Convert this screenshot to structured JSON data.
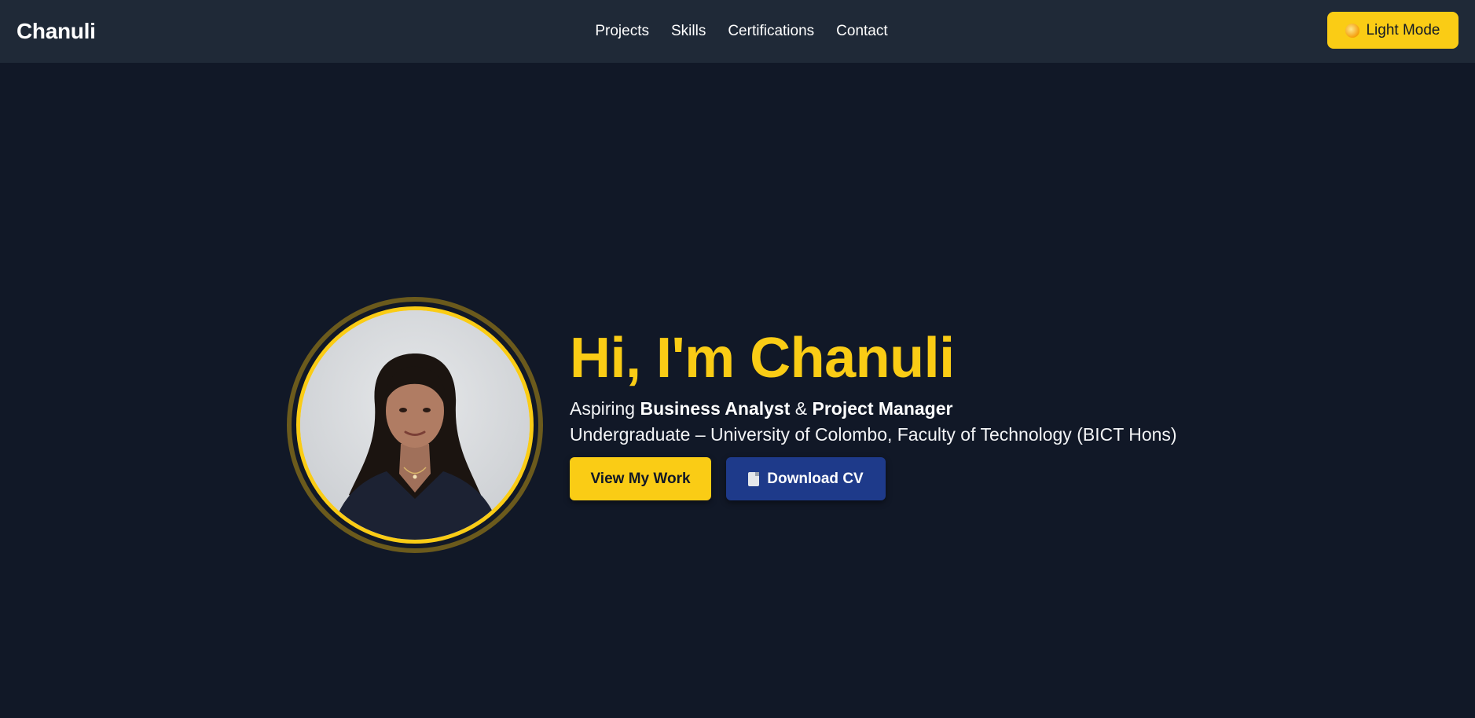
{
  "header": {
    "brand": "Chanuli",
    "nav": [
      {
        "label": "Projects"
      },
      {
        "label": "Skills"
      },
      {
        "label": "Certifications"
      },
      {
        "label": "Contact"
      }
    ],
    "theme_toggle": {
      "label": "Light Mode",
      "icon": "sun-icon"
    }
  },
  "hero": {
    "title": "Hi, I'm Chanuli",
    "tagline": {
      "prefix": "Aspiring ",
      "role1": "Business Analyst",
      "joiner": " & ",
      "role2": "Project Manager"
    },
    "education": "Undergraduate – University of Colombo, Faculty of Technology (BICT Hons)",
    "buttons": {
      "view_work": "View My Work",
      "download_cv": "Download CV",
      "download_icon": "document-icon"
    }
  },
  "colors": {
    "background": "#111827",
    "navbar": "#1f2937",
    "accent": "#facc15",
    "secondary_button": "#1e3a8a"
  }
}
